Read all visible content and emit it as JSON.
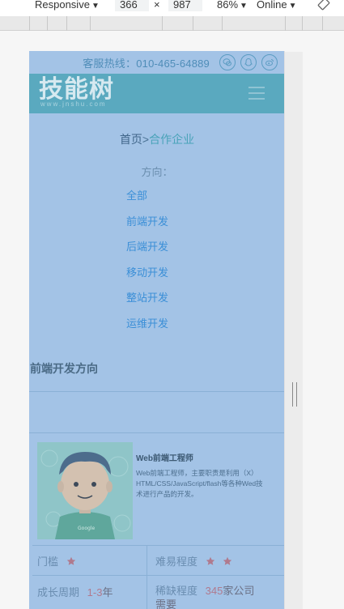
{
  "devtools": {
    "device_mode": "Responsive",
    "width": "366",
    "times": "×",
    "height": "987",
    "zoom": "86%",
    "network": "Online"
  },
  "site": {
    "hotline": "客服热线：010-465-64889",
    "logo_main": "技能树",
    "logo_sub": "www.jnshu.com",
    "breadcrumb": {
      "home": "首页",
      "separator": ">",
      "current": "合作企业"
    },
    "direction_label": "方向：",
    "directions": [
      "全部",
      "前端开发",
      "后端开发",
      "移动开发",
      "整站开发",
      "运维开发"
    ],
    "section_title": "前端开发方向",
    "card": {
      "title": "Web前端工程师",
      "description": "Web前端工程师，主要职责是利用（X）HTML/CSS/JavaScript/flash等各种Wed技术进行产品的开发。",
      "badge": "Google",
      "threshold_label": "门槛",
      "threshold_stars": 1,
      "difficulty_label": "难易程度",
      "difficulty_stars": 2,
      "growth_label": "成长周期",
      "growth_value": "1-3",
      "growth_unit": "年",
      "shortage_label": "稀缺程度",
      "shortage_value": "345",
      "shortage_tail": "家公司需要"
    }
  },
  "colors": {
    "overlay_blue": "#a3c3e6",
    "header_teal": "#5aa9bf",
    "link_blue": "#3b8fd7",
    "star": "#b07a8e"
  }
}
